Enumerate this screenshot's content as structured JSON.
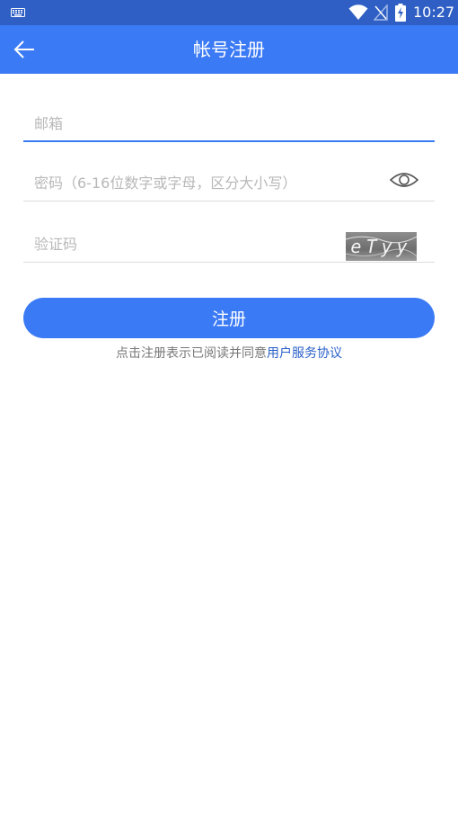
{
  "status_bar": {
    "time": "10:27",
    "icons": [
      "keyboard-icon",
      "wifi-icon",
      "no-signal-icon",
      "battery-charging-icon"
    ]
  },
  "app_bar": {
    "title": "帐号注册",
    "back_icon": "arrow-left-icon"
  },
  "form": {
    "email_placeholder": "邮箱",
    "password_placeholder": "密码（6-16位数字或字母，区分大小写）",
    "captcha_placeholder": "验证码",
    "captcha_text": "eTyy",
    "password_toggle_icon": "eye-icon"
  },
  "register_button": "注册",
  "agreement": {
    "prefix": "点击注册表示已阅读并同意",
    "link": "用户服务协议"
  },
  "colors": {
    "primary": "#3b7af5",
    "status_bar": "#2f5fc4",
    "link": "#2a60c8"
  }
}
